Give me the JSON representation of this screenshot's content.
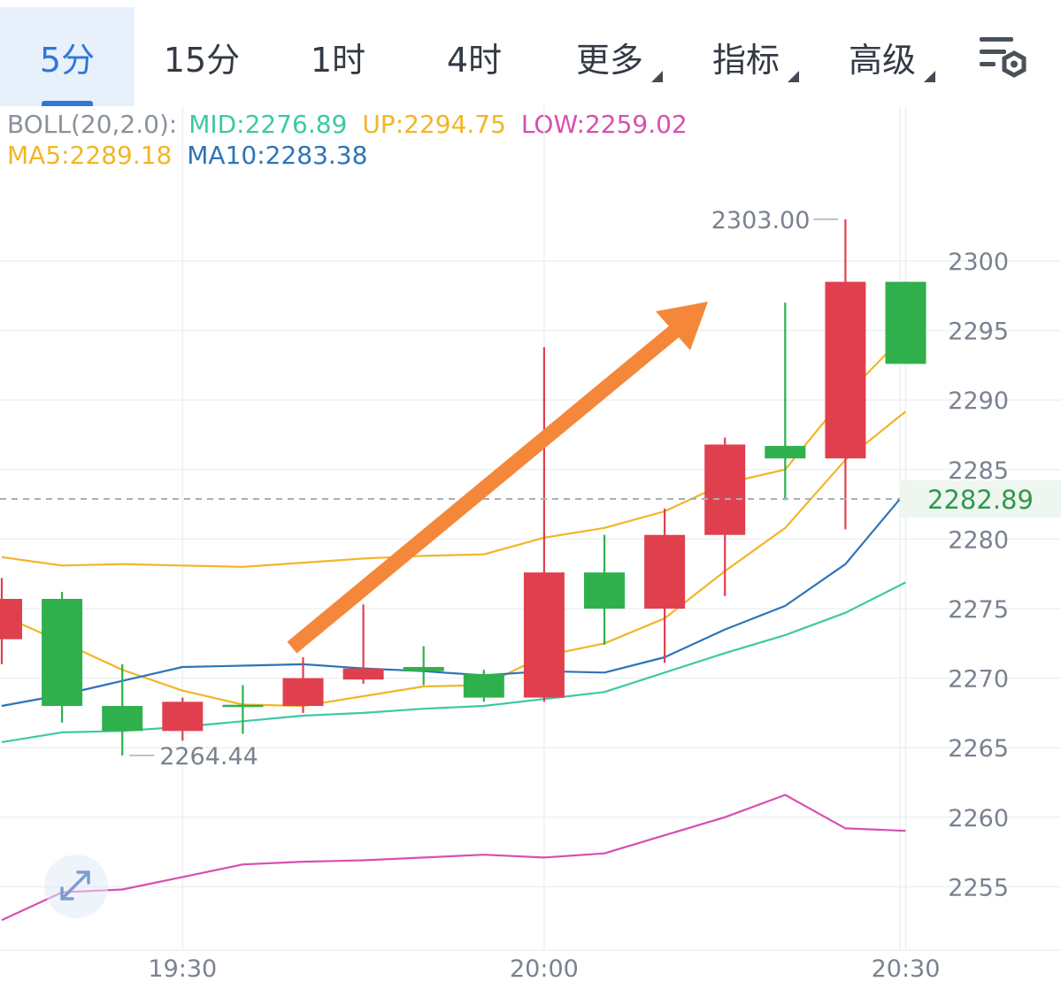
{
  "tabs": [
    {
      "label": "5分",
      "active": true,
      "dropdown": false
    },
    {
      "label": "15分",
      "active": false,
      "dropdown": false
    },
    {
      "label": "1时",
      "active": false,
      "dropdown": false
    },
    {
      "label": "4时",
      "active": false,
      "dropdown": false
    },
    {
      "label": "更多",
      "active": false,
      "dropdown": true
    },
    {
      "label": "指标",
      "active": false,
      "dropdown": true
    },
    {
      "label": "高级",
      "active": false,
      "dropdown": true
    }
  ],
  "settings_icon": "chart-settings-icon",
  "zoom_icon": "expand-arrows-icon",
  "indicators": {
    "boll_label": "BOLL(20,2.0):",
    "mid_label": "MID:2276.89",
    "up_label": "UP:2294.75",
    "low_label": "LOW:2259.02",
    "ma5_label": "MA5:2289.18",
    "ma10_label": "MA10:2283.38"
  },
  "colors": {
    "up_candle": "#e0404e",
    "down_candle": "#2fb04d",
    "mid": "#3cc9a4",
    "up": "#f2b526",
    "low": "#d74fb0",
    "ma5": "#f2b526",
    "ma10": "#2e74b8",
    "arrow": "#f5873a",
    "boll_text": "#8a919c",
    "accent": "#2f78d6"
  },
  "current_price": "2282.89",
  "annotations": {
    "high_label": "2303.00",
    "low_label": "2264.44"
  },
  "chart_data": {
    "type": "candlestick",
    "y_ticks": [
      2255,
      2260,
      2265,
      2270,
      2275,
      2280,
      2285,
      2290,
      2295,
      2300
    ],
    "x_ticks": [
      "19:30",
      "20:00",
      "20:30"
    ],
    "x_tick_index": [
      3,
      9,
      15
    ],
    "ylim": [
      2251,
      2305
    ],
    "grid": true,
    "candles": [
      {
        "o": 2275.7,
        "c": 2272.8,
        "h": 2277.2,
        "l": 2271.0
      },
      {
        "o": 2268.0,
        "c": 2275.7,
        "h": 2276.2,
        "l": 2266.8
      },
      {
        "o": 2266.2,
        "c": 2268.0,
        "h": 2271.0,
        "l": 2264.44
      },
      {
        "o": 2268.3,
        "c": 2266.2,
        "h": 2268.6,
        "l": 2265.5
      },
      {
        "o": 2268.0,
        "c": 2268.0,
        "h": 2269.5,
        "l": 2266.0
      },
      {
        "o": 2270.0,
        "c": 2268.0,
        "h": 2271.5,
        "l": 2267.5
      },
      {
        "o": 2270.7,
        "c": 2269.9,
        "h": 2275.3,
        "l": 2269.6
      },
      {
        "o": 2270.5,
        "c": 2270.8,
        "h": 2272.3,
        "l": 2269.5
      },
      {
        "o": 2268.6,
        "c": 2270.3,
        "h": 2270.6,
        "l": 2268.3
      },
      {
        "o": 2277.6,
        "c": 2268.6,
        "h": 2293.8,
        "l": 2268.3
      },
      {
        "o": 2275.0,
        "c": 2277.6,
        "h": 2280.3,
        "l": 2272.4
      },
      {
        "o": 2280.3,
        "c": 2275.0,
        "h": 2282.2,
        "l": 2271.1
      },
      {
        "o": 2286.8,
        "c": 2280.3,
        "h": 2287.3,
        "l": 2275.9
      },
      {
        "o": 2285.8,
        "c": 2286.7,
        "h": 2297.0,
        "l": 2282.8
      },
      {
        "o": 2298.5,
        "c": 2285.8,
        "h": 2303.0,
        "l": 2280.7
      },
      {
        "o": 2292.6,
        "c": 2298.5,
        "h": 2298.5,
        "l": 2292.6
      }
    ],
    "series": [
      {
        "name": "UP",
        "values": [
          2278.7,
          2278.1,
          2278.2,
          2278.1,
          2278.0,
          2278.3,
          2278.6,
          2278.8,
          2278.9,
          2280.1,
          2280.8,
          2282.0,
          2284.0,
          2285.0,
          2290.3,
          2294.75
        ]
      },
      {
        "name": "MA5",
        "values": [
          2274.5,
          2272.6,
          2270.6,
          2269.1,
          2268.1,
          2268.0,
          2268.7,
          2269.4,
          2269.5,
          2271.6,
          2272.5,
          2274.3,
          2277.7,
          2280.8,
          2285.7,
          2289.18
        ]
      },
      {
        "name": "MA10",
        "values": [
          2268.0,
          2268.8,
          2269.8,
          2270.8,
          2270.9,
          2271.0,
          2270.7,
          2270.5,
          2270.2,
          2270.5,
          2270.4,
          2271.5,
          2273.5,
          2275.2,
          2278.2,
          2283.38
        ]
      },
      {
        "name": "MID",
        "values": [
          2265.4,
          2266.1,
          2266.2,
          2266.5,
          2266.9,
          2267.3,
          2267.5,
          2267.8,
          2268.0,
          2268.5,
          2269.0,
          2270.4,
          2271.8,
          2273.1,
          2274.7,
          2276.89
        ]
      },
      {
        "name": "LOW",
        "values": [
          2252.6,
          2254.6,
          2254.8,
          2255.7,
          2256.6,
          2256.8,
          2256.9,
          2257.1,
          2257.3,
          2257.1,
          2257.4,
          2258.7,
          2260.0,
          2261.6,
          2259.2,
          2259.02
        ]
      }
    ]
  }
}
